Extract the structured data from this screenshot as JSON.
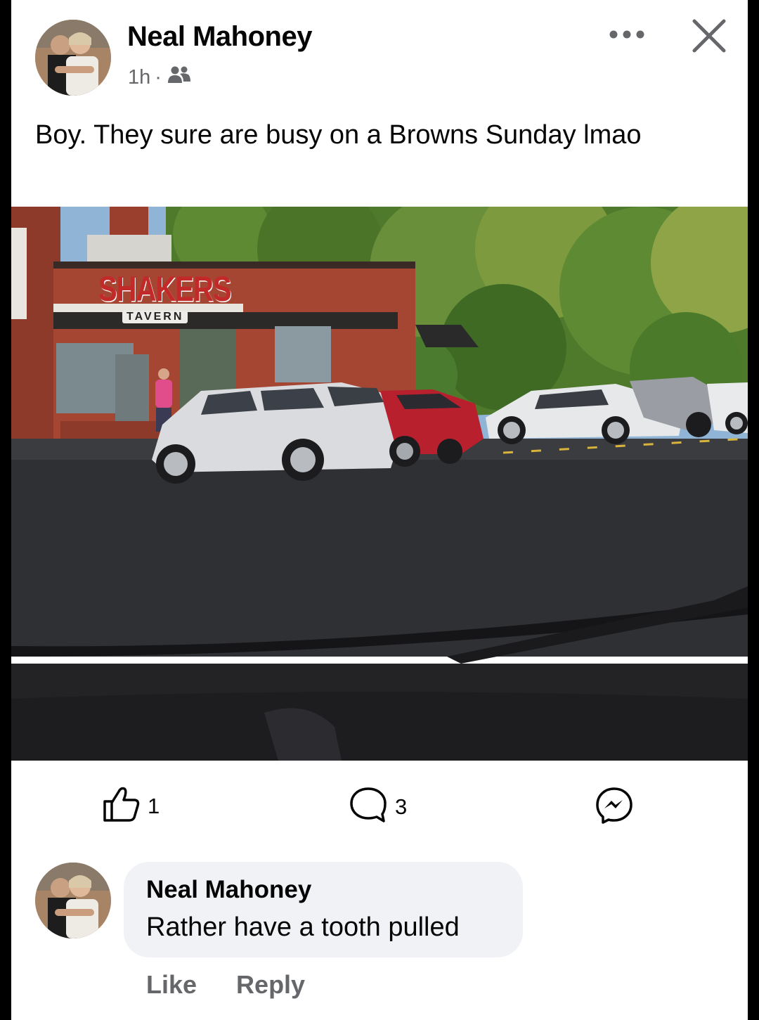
{
  "post": {
    "author": "Neal Mahoney",
    "time": "1h",
    "separator": "·",
    "audience_icon": "friends-icon",
    "text": "Boy. They sure are busy on a Browns Sunday lmao",
    "photo": {
      "sign_main": "SHAKERS",
      "sign_sub": "TAVERN"
    }
  },
  "actions": {
    "like_count": "1",
    "comment_count": "3",
    "like_icon": "thumbs-up-icon",
    "comment_icon": "comment-bubble-icon",
    "share_icon": "messenger-icon"
  },
  "comment": {
    "author": "Neal Mahoney",
    "text": "Rather have a tooth pulled",
    "like_label": "Like",
    "reply_label": "Reply"
  },
  "colors": {
    "text_primary": "#050505",
    "text_secondary": "#65676b",
    "bubble": "#f0f2f5"
  }
}
